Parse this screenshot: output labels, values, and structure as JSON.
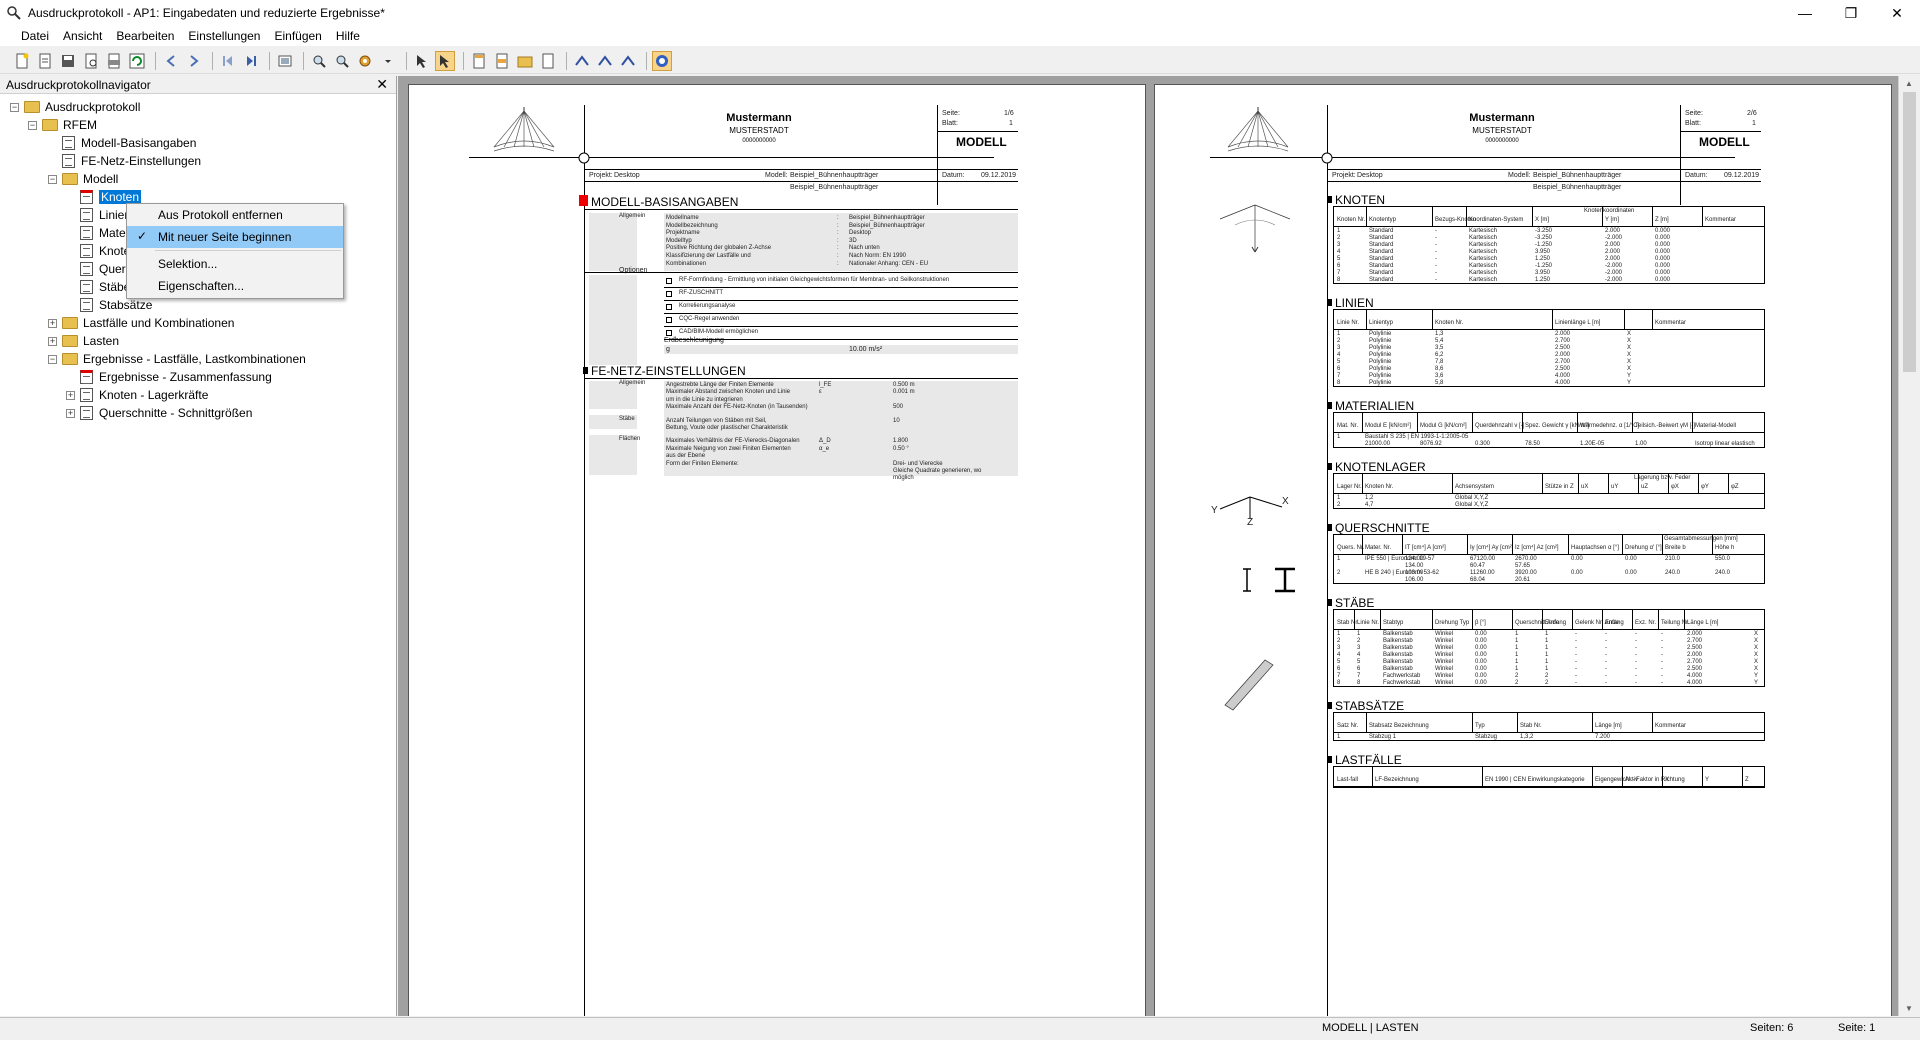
{
  "window": {
    "title": "Ausdruckprotokoll - AP1: Eingabedaten und reduzierte Ergebnisse*",
    "minimize": "—",
    "maximize": "❐",
    "close": "✕"
  },
  "menu": [
    "Datei",
    "Ansicht",
    "Bearbeiten",
    "Einstellungen",
    "Einfügen",
    "Hilfe"
  ],
  "navigator": {
    "title": "Ausdruckprotokollnavigator",
    "close": "✕",
    "tree": [
      {
        "label": "Ausdruckprotokoll",
        "level": 0,
        "icon": "folder",
        "expander": "−"
      },
      {
        "label": "RFEM",
        "level": 1,
        "icon": "folder",
        "expander": "−"
      },
      {
        "label": "Modell-Basisangaben",
        "level": 2,
        "icon": "doc",
        "expander": ""
      },
      {
        "label": "FE-Netz-Einstellungen",
        "level": 2,
        "icon": "doc",
        "expander": ""
      },
      {
        "label": "Modell",
        "level": 2,
        "icon": "folder",
        "expander": "−"
      },
      {
        "label": "Knoten",
        "level": 3,
        "icon": "doc-red",
        "expander": "",
        "selected": true
      },
      {
        "label": "Linien",
        "level": 3,
        "icon": "doc",
        "expander": ""
      },
      {
        "label": "Materialien",
        "level": 3,
        "icon": "doc",
        "expander": ""
      },
      {
        "label": "Knotenlager",
        "level": 3,
        "icon": "doc",
        "expander": ""
      },
      {
        "label": "Querschnitte",
        "level": 3,
        "icon": "doc",
        "expander": ""
      },
      {
        "label": "Stäbe",
        "level": 3,
        "icon": "doc",
        "expander": ""
      },
      {
        "label": "Stabsätze",
        "level": 3,
        "icon": "doc",
        "expander": ""
      },
      {
        "label": "Lastfälle und Kombinationen",
        "level": 2,
        "icon": "folder",
        "expander": "+"
      },
      {
        "label": "Lasten",
        "level": 2,
        "icon": "folder",
        "expander": "+"
      },
      {
        "label": "Ergebnisse - Lastfälle, Lastkombinationen",
        "level": 2,
        "icon": "folder",
        "expander": "−"
      },
      {
        "label": "Ergebnisse - Zusammenfassung",
        "level": 3,
        "icon": "doc-red",
        "expander": ""
      },
      {
        "label": "Knoten - Lagerkräfte",
        "level": 3,
        "icon": "doc",
        "expander": "+"
      },
      {
        "label": "Querschnitte - Schnittgrößen",
        "level": 3,
        "icon": "doc",
        "expander": "+"
      }
    ]
  },
  "context_menu": {
    "items": [
      {
        "label": "Aus Protokoll entfernen",
        "checked": false,
        "highlight": false
      },
      {
        "label": "Mit neuer Seite beginnen",
        "checked": true,
        "highlight": true
      },
      {
        "label": "Selektion...",
        "checked": false,
        "highlight": false
      },
      {
        "label": "Eigenschaften...",
        "checked": false,
        "highlight": false
      }
    ],
    "check_glyph": "✓"
  },
  "page1": {
    "company": "Mustermann",
    "city": "MUSTERSTADT",
    "number": "0000000000",
    "seite_label": "Seite:",
    "seite_value": "1/6",
    "blatt_label": "Blatt:",
    "blatt_value": "1",
    "box_title": "MODELL",
    "projekt_label": "Projekt:",
    "projekt_value": "Desktop",
    "modell_label": "Modell:",
    "modell_value": "Beispiel_Bühnenhauptträger",
    "modell_value2": "Beispiel_Bühnenhauptträger",
    "datum_label": "Datum:",
    "datum_value": "09.12.2019",
    "sections": [
      "MODELL-BASISANGABEN",
      "FE-NETZ-EINSTELLUNGEN"
    ],
    "basis_rows": [
      [
        "Allgemein",
        "Modellname",
        "Beispiel_Bühnenhauptträger"
      ],
      [
        "",
        "Modellbezeichnung",
        "Beispiel_Bühnenhauptträger"
      ],
      [
        "",
        "Projektname",
        "Desktop"
      ],
      [
        "",
        "Modelltyp",
        "3D"
      ],
      [
        "",
        "Positive Richtung der globalen Z-Achse",
        "Nach unten"
      ],
      [
        "",
        "Klassifizierung der Lastfälle und",
        "Nach Norm: EN 1990"
      ],
      [
        "",
        "Kombinationen",
        "Nationaler Anhang: CEN - EU"
      ]
    ],
    "optionen": [
      "RF-Formfindung - Ermittlung von initialen Gleichgewichtsformen für Membran- und Seilkonstruktionen",
      "RF-ZUSCHNITT",
      "Korrelierungsanalyse",
      "CQC-Regel anwenden",
      "CAD/BIM-Modell ermöglichen"
    ],
    "optionen_label": "Optionen",
    "erdbeschl_label": "Erdbeschleunigung",
    "erdbeschl_sym": "g",
    "erdbeschl_value": "10.00 m/s²",
    "fe_rows": [
      [
        "Allgemein",
        "Angestrebte Länge der Finiten Elemente",
        "l_FE",
        "0.500 m"
      ],
      [
        "",
        "Maximaler Abstand zwischen Knoten und Linie",
        "ε",
        "0.001 m"
      ],
      [
        "",
        "um in die Linie zu integrieren",
        "",
        ""
      ],
      [
        "",
        "Maximale Anzahl der FE-Netz-Knoten (in Tausenden)",
        "",
        "500"
      ],
      [
        "Stäbe",
        "Anzahl Teilungen von Stäben mit Seil,",
        "",
        "10"
      ],
      [
        "",
        "Bettung, Voute oder plastischer Charakteristik",
        "",
        ""
      ],
      [
        "Flächen",
        "Maximales Verhältnis der FE-Vierecks-Diagonalen",
        "Δ_D",
        "1.800"
      ],
      [
        "",
        "Maximale Neigung von zwei Finiten Elementen",
        "α_e",
        "0.50 °"
      ],
      [
        "",
        "aus der Ebene",
        "",
        ""
      ],
      [
        "",
        "Form der Finiten Elemente:",
        "",
        "Drei- und Vierecke"
      ],
      [
        "",
        "",
        "",
        "Gleiche Quadrate generieren, wo"
      ],
      [
        "",
        "",
        "",
        "möglich"
      ]
    ]
  },
  "page2": {
    "company": "Mustermann",
    "city": "MUSTERSTADT",
    "number": "0000000000",
    "seite_label": "Seite:",
    "seite_value": "2/6",
    "blatt_label": "Blatt:",
    "blatt_value": "1",
    "box_title": "MODELL",
    "projekt_label": "Projekt:",
    "projekt_value": "Desktop",
    "modell_label": "Modell:",
    "modell_value": "Beispiel_Bühnenhauptträger",
    "modell_value2": "Beispiel_Bühnenhauptträger",
    "datum_label": "Datum:",
    "datum_value": "09.12.2019",
    "sections": [
      "KNOTEN",
      "LINIEN",
      "MATERIALIEN",
      "KNOTENLAGER",
      "QUERSCHNITTE",
      "STÄBE",
      "STABSÄTZE",
      "LASTFÄLLE"
    ],
    "knoten_headers": [
      "Knoten Nr.",
      "Knotentyp",
      "Bezugs-Knoten",
      "Koordinaten-System",
      "X [m]",
      "Y [m]",
      "Z [m]",
      "Kommentar"
    ],
    "knoten_group": "Knotenkoordinaten",
    "knoten_rows": [
      [
        "1",
        "Standard",
        "-",
        "Kartesisch",
        "-3.250",
        "2.000",
        "0.000"
      ],
      [
        "2",
        "Standard",
        "-",
        "Kartesisch",
        "-3.250",
        "-2.000",
        "0.000"
      ],
      [
        "3",
        "Standard",
        "-",
        "Kartesisch",
        "-1.250",
        "2.000",
        "0.000"
      ],
      [
        "4",
        "Standard",
        "-",
        "Kartesisch",
        "3.950",
        "2.000",
        "0.000"
      ],
      [
        "5",
        "Standard",
        "-",
        "Kartesisch",
        "1.250",
        "2.000",
        "0.000"
      ],
      [
        "6",
        "Standard",
        "-",
        "Kartesisch",
        "-1.250",
        "-2.000",
        "0.000"
      ],
      [
        "7",
        "Standard",
        "-",
        "Kartesisch",
        "3.950",
        "-2.000",
        "0.000"
      ],
      [
        "8",
        "Standard",
        "-",
        "Kartesisch",
        "1.250",
        "-2.000",
        "0.000"
      ]
    ],
    "linien_headers": [
      "Linie Nr.",
      "Linientyp",
      "Knoten Nr.",
      "Linienlänge L [m]",
      "",
      "Kommentar"
    ],
    "linien_rows": [
      [
        "1",
        "Polylinie",
        "1,3",
        "2.000",
        "X"
      ],
      [
        "2",
        "Polylinie",
        "5,4",
        "2.700",
        "X"
      ],
      [
        "3",
        "Polylinie",
        "3,5",
        "2.500",
        "X"
      ],
      [
        "4",
        "Polylinie",
        "6,2",
        "2.000",
        "X"
      ],
      [
        "5",
        "Polylinie",
        "7,8",
        "2.700",
        "X"
      ],
      [
        "6",
        "Polylinie",
        "8,6",
        "2.500",
        "X"
      ],
      [
        "7",
        "Polylinie",
        "3,6",
        "4.000",
        "Y"
      ],
      [
        "8",
        "Polylinie",
        "5,8",
        "4.000",
        "Y"
      ]
    ],
    "material_headers": [
      "Mat. Nr.",
      "Modul E [kN/cm²]",
      "Modul G [kN/cm²]",
      "Querdehnzahl ν [-]",
      "Spez. Gewicht γ [kN/m³]",
      "Wärmedehnz. α [1/°C]",
      "Teilsich.-Beiwert γM [-]",
      "Material-Modell"
    ],
    "material_rows": [
      [
        "1",
        "Baustahl S 235 | EN 1993-1-1:2005-05",
        "",
        "",
        "",
        "",
        "",
        ""
      ],
      [
        "",
        "21000.00",
        "8076.92",
        "0.300",
        "78.50",
        "1.20E-05",
        "1.00",
        "Isotrop linear elastisch"
      ]
    ],
    "lager_headers": [
      "Lager Nr.",
      "Knoten Nr.",
      "Achsensystem",
      "Stütze in Z",
      "uX",
      "uY",
      "uZ",
      "φX",
      "φY",
      "φZ"
    ],
    "lager_group": "Lagerung bzw. Feder",
    "lager_rows": [
      [
        "1",
        "1,2",
        "Global X,Y,Z"
      ],
      [
        "2",
        "4,7",
        "Global X,Y,Z"
      ]
    ],
    "qs_headers": [
      "Quers. Nr.",
      "Mater. Nr.",
      "IT [cm⁴] A [cm²]",
      "Iy [cm⁴] Ay [cm²]",
      "Iz [cm⁴] Az [cm²]",
      "Hauptachsen α [°]",
      "Drehung α' [°]",
      "Breite b",
      "Höhe h"
    ],
    "qs_group": "Gesamtabmessungen [mm]",
    "qs_rows": [
      [
        "1",
        "IPE 550 | Euronorm 19-57",
        "124.00",
        "67120.00",
        "2670.00",
        "0.00",
        "0.00",
        "210.0",
        "550.0"
      ],
      [
        "",
        "",
        "134.00",
        "60.47",
        "57.65",
        "",
        "",
        "",
        ""
      ],
      [
        "2",
        "HE B 240 | Euronorm 53-62",
        "103.00",
        "11260.00",
        "3920.00",
        "0.00",
        "0.00",
        "240.0",
        "240.0"
      ],
      [
        "",
        "",
        "106.00",
        "68.04",
        "20.61",
        "",
        "",
        "",
        ""
      ]
    ],
    "staebe_headers": [
      "Stab Nr.",
      "Linie Nr.",
      "Stabtyp",
      "Drehung Typ",
      "β [°]",
      "Querschnitt Anfang",
      "Ende",
      "Gelenk Nr. Anfang",
      "Ende",
      "Exz. Nr.",
      "Teilung Nr.",
      "Länge L [m]"
    ],
    "staebe_rows": [
      [
        "1",
        "1",
        "Balkenstab",
        "Winkel",
        "0.00",
        "1",
        "1",
        "-",
        "-",
        "-",
        "-",
        "2.000",
        "X"
      ],
      [
        "2",
        "2",
        "Balkenstab",
        "Winkel",
        "0.00",
        "1",
        "1",
        "-",
        "-",
        "-",
        "-",
        "2.700",
        "X"
      ],
      [
        "3",
        "3",
        "Balkenstab",
        "Winkel",
        "0.00",
        "1",
        "1",
        "-",
        "-",
        "-",
        "-",
        "2.500",
        "X"
      ],
      [
        "4",
        "4",
        "Balkenstab",
        "Winkel",
        "0.00",
        "1",
        "1",
        "-",
        "-",
        "-",
        "-",
        "2.000",
        "X"
      ],
      [
        "5",
        "5",
        "Balkenstab",
        "Winkel",
        "0.00",
        "1",
        "1",
        "-",
        "-",
        "-",
        "-",
        "2.700",
        "X"
      ],
      [
        "6",
        "6",
        "Balkenstab",
        "Winkel",
        "0.00",
        "1",
        "1",
        "-",
        "-",
        "-",
        "-",
        "2.500",
        "X"
      ],
      [
        "7",
        "7",
        "Fachwerkstab",
        "Winkel",
        "0.00",
        "2",
        "2",
        "-",
        "-",
        "-",
        "-",
        "4.000",
        "Y"
      ],
      [
        "8",
        "8",
        "Fachwerkstab",
        "Winkel",
        "0.00",
        "2",
        "2",
        "-",
        "-",
        "-",
        "-",
        "4.000",
        "Y"
      ]
    ],
    "stabsatz_headers": [
      "Satz Nr.",
      "Stabsatz Bezeichnung",
      "Typ",
      "Stab Nr.",
      "Länge [m]",
      "Kommentar"
    ],
    "stabsatz_rows": [
      [
        "1",
        "Stabzug 1",
        "Stabzug",
        "1,3,2",
        "7.200",
        ""
      ]
    ],
    "lf_headers": [
      "Last-fall",
      "LF-Bezeichnung",
      "EN 1990 | CEN Einwirkungskategorie",
      "Eigengewicht - Faktor in Richtung",
      "Aktiv",
      "X",
      "Y",
      "Z"
    ],
    "axis_labels": {
      "y": "Y",
      "x": "X",
      "z": "Z"
    }
  },
  "status": {
    "left": "MODELL | LASTEN",
    "pages": "Seiten: 6",
    "page": "Seite: 1"
  }
}
